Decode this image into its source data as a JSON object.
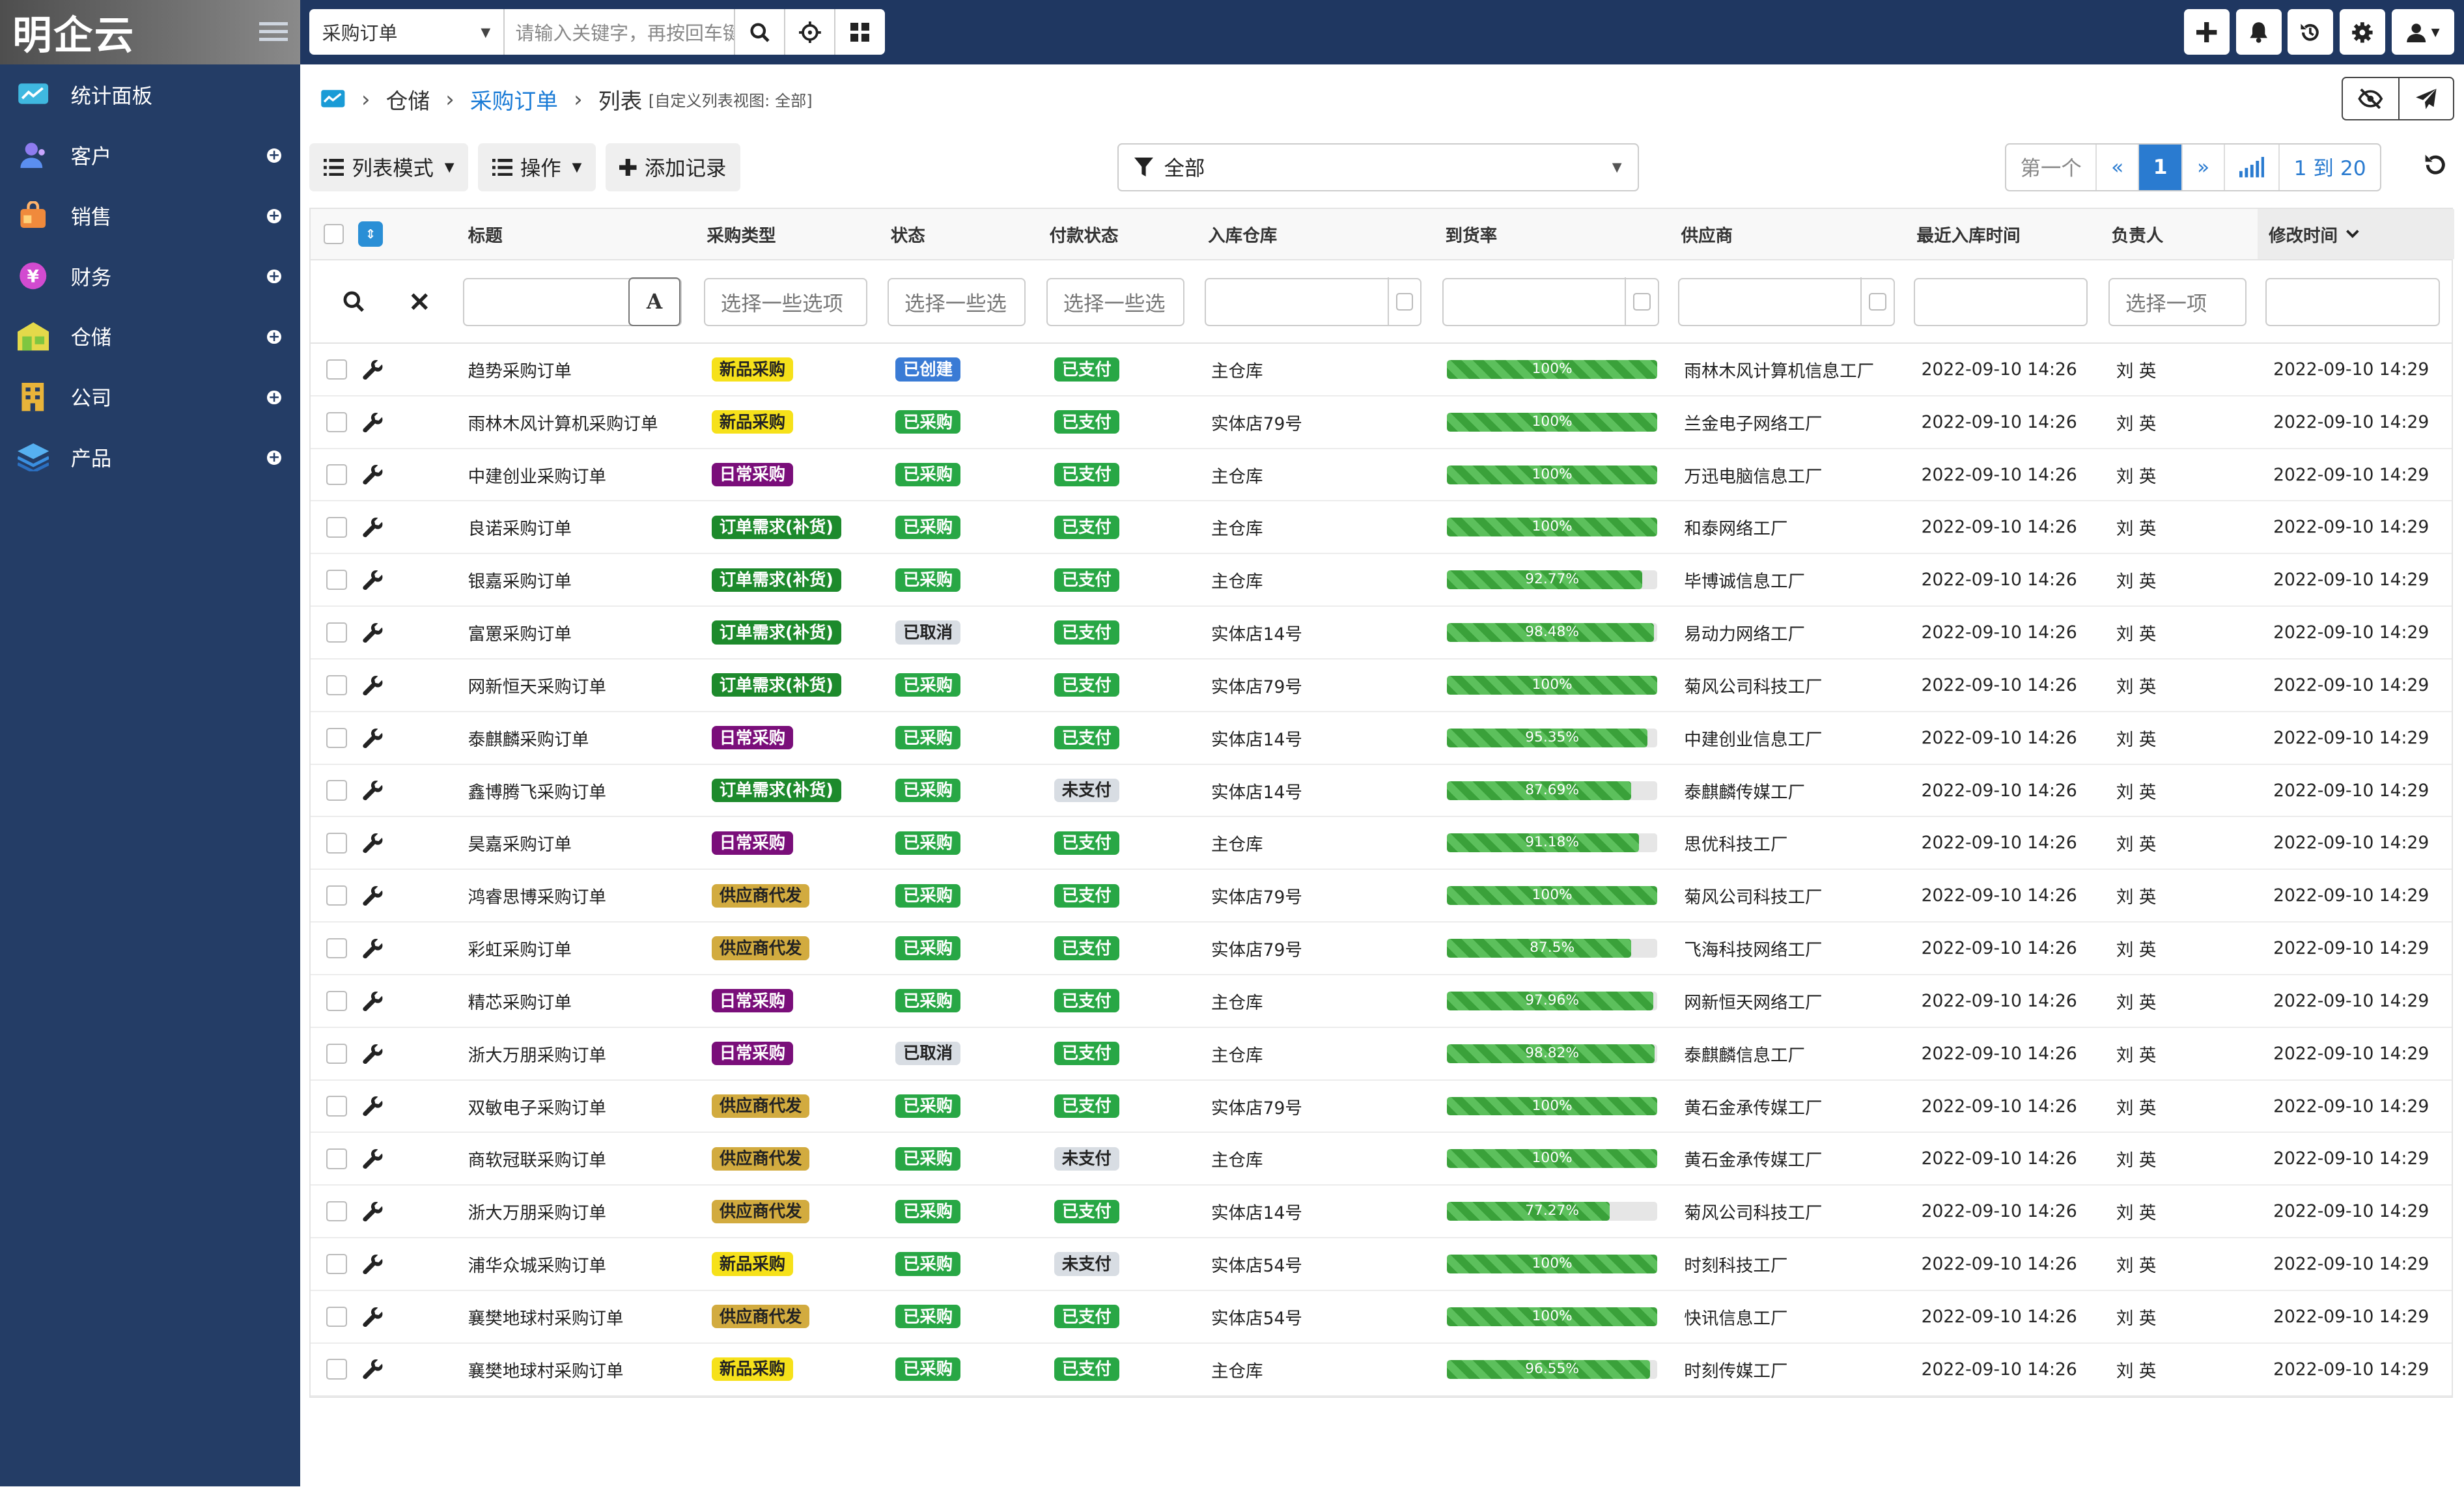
{
  "app": {
    "logo": "明企云"
  },
  "sidebar": {
    "items": [
      {
        "label": "统计面板",
        "icon": "chart-icon",
        "expandable": false
      },
      {
        "label": "客户",
        "icon": "users-icon",
        "expandable": true
      },
      {
        "label": "销售",
        "icon": "bag-icon",
        "expandable": true
      },
      {
        "label": "财务",
        "icon": "yen-icon",
        "expandable": true
      },
      {
        "label": "仓储",
        "icon": "warehouse-icon",
        "expandable": true
      },
      {
        "label": "公司",
        "icon": "building-icon",
        "expandable": true
      },
      {
        "label": "产品",
        "icon": "layers-icon",
        "expandable": true
      }
    ]
  },
  "topbar": {
    "module_select": "采购订单",
    "search_placeholder": "请输入关键字，再按回车键"
  },
  "breadcrumb": {
    "level1": "仓储",
    "level2": "采购订单",
    "level3": "列表",
    "note": "[自定义列表视图: 全部]"
  },
  "toolbar": {
    "list_mode": "列表模式",
    "actions": "操作",
    "add_record": "添加记录"
  },
  "filter": {
    "label": "全部"
  },
  "pager": {
    "first": "第一个",
    "prev": "«",
    "current": "1",
    "next": "»",
    "range": "1 到 20"
  },
  "columns": [
    "标题",
    "采购类型",
    "状态",
    "付款状态",
    "入库仓库",
    "到货率",
    "供应商",
    "最近入库时间",
    "负责人",
    "修改时间"
  ],
  "filters": {
    "type_placeholder": "选择一些选项",
    "status_placeholder": "选择一些选",
    "pay_placeholder": "选择一些选",
    "owner_placeholder": "选择一项",
    "text_toggle": "A"
  },
  "colors": {
    "sidebar": "#243d66",
    "topbar": "#1f3761",
    "link": "#1a7bd6",
    "progress": "#3aa13a"
  },
  "rows": [
    {
      "title": "趋势采购订单",
      "type": "新品采购",
      "status": "已创建",
      "pay": "已支付",
      "warehouse": "主仓库",
      "rate": 100,
      "rate_text": "100%",
      "supplier": "雨林木风计算机信息工厂",
      "in_time": "2022-09-10 14:26",
      "owner": "刘 英",
      "mod_time": "2022-09-10 14:29"
    },
    {
      "title": "雨林木风计算机采购订单",
      "type": "新品采购",
      "status": "已采购",
      "pay": "已支付",
      "warehouse": "实体店79号",
      "rate": 100,
      "rate_text": "100%",
      "supplier": "兰金电子网络工厂",
      "in_time": "2022-09-10 14:26",
      "owner": "刘 英",
      "mod_time": "2022-09-10 14:29"
    },
    {
      "title": "中建创业采购订单",
      "type": "日常采购",
      "status": "已采购",
      "pay": "已支付",
      "warehouse": "主仓库",
      "rate": 100,
      "rate_text": "100%",
      "supplier": "万迅电脑信息工厂",
      "in_time": "2022-09-10 14:26",
      "owner": "刘 英",
      "mod_time": "2022-09-10 14:29"
    },
    {
      "title": "良诺采购订单",
      "type": "订单需求(补货)",
      "status": "已采购",
      "pay": "已支付",
      "warehouse": "主仓库",
      "rate": 100,
      "rate_text": "100%",
      "supplier": "和泰网络工厂",
      "in_time": "2022-09-10 14:26",
      "owner": "刘 英",
      "mod_time": "2022-09-10 14:29"
    },
    {
      "title": "银嘉采购订单",
      "type": "订单需求(补货)",
      "status": "已采购",
      "pay": "已支付",
      "warehouse": "主仓库",
      "rate": 92.77,
      "rate_text": "92.77%",
      "supplier": "毕博诚信息工厂",
      "in_time": "2022-09-10 14:26",
      "owner": "刘 英",
      "mod_time": "2022-09-10 14:29"
    },
    {
      "title": "富罳采购订单",
      "type": "订单需求(补货)",
      "status": "已取消",
      "pay": "已支付",
      "warehouse": "实体店14号",
      "rate": 98.48,
      "rate_text": "98.48%",
      "supplier": "易动力网络工厂",
      "in_time": "2022-09-10 14:26",
      "owner": "刘 英",
      "mod_time": "2022-09-10 14:29"
    },
    {
      "title": "网新恒天采购订单",
      "type": "订单需求(补货)",
      "status": "已采购",
      "pay": "已支付",
      "warehouse": "实体店79号",
      "rate": 100,
      "rate_text": "100%",
      "supplier": "菊风公司科技工厂",
      "in_time": "2022-09-10 14:26",
      "owner": "刘 英",
      "mod_time": "2022-09-10 14:29"
    },
    {
      "title": "泰麒麟采购订单",
      "type": "日常采购",
      "status": "已采购",
      "pay": "已支付",
      "warehouse": "实体店14号",
      "rate": 95.35,
      "rate_text": "95.35%",
      "supplier": "中建创业信息工厂",
      "in_time": "2022-09-10 14:26",
      "owner": "刘 英",
      "mod_time": "2022-09-10 14:29"
    },
    {
      "title": "鑫博腾飞采购订单",
      "type": "订单需求(补货)",
      "status": "已采购",
      "pay": "未支付",
      "warehouse": "实体店14号",
      "rate": 87.69,
      "rate_text": "87.69%",
      "supplier": "泰麒麟传媒工厂",
      "in_time": "2022-09-10 14:26",
      "owner": "刘 英",
      "mod_time": "2022-09-10 14:29"
    },
    {
      "title": "昊嘉采购订单",
      "type": "日常采购",
      "status": "已采购",
      "pay": "已支付",
      "warehouse": "主仓库",
      "rate": 91.18,
      "rate_text": "91.18%",
      "supplier": "思优科技工厂",
      "in_time": "2022-09-10 14:26",
      "owner": "刘 英",
      "mod_time": "2022-09-10 14:29"
    },
    {
      "title": "鸿睿思博采购订单",
      "type": "供应商代发",
      "status": "已采购",
      "pay": "已支付",
      "warehouse": "实体店79号",
      "rate": 100,
      "rate_text": "100%",
      "supplier": "菊风公司科技工厂",
      "in_time": "2022-09-10 14:26",
      "owner": "刘 英",
      "mod_time": "2022-09-10 14:29"
    },
    {
      "title": "彩虹采购订单",
      "type": "供应商代发",
      "status": "已采购",
      "pay": "已支付",
      "warehouse": "实体店79号",
      "rate": 87.5,
      "rate_text": "87.5%",
      "supplier": "飞海科技网络工厂",
      "in_time": "2022-09-10 14:26",
      "owner": "刘 英",
      "mod_time": "2022-09-10 14:29"
    },
    {
      "title": "精芯采购订单",
      "type": "日常采购",
      "status": "已采购",
      "pay": "已支付",
      "warehouse": "主仓库",
      "rate": 97.96,
      "rate_text": "97.96%",
      "supplier": "网新恒天网络工厂",
      "in_time": "2022-09-10 14:26",
      "owner": "刘 英",
      "mod_time": "2022-09-10 14:29"
    },
    {
      "title": "浙大万朋采购订单",
      "type": "日常采购",
      "status": "已取消",
      "pay": "已支付",
      "warehouse": "主仓库",
      "rate": 98.82,
      "rate_text": "98.82%",
      "supplier": "泰麒麟信息工厂",
      "in_time": "2022-09-10 14:26",
      "owner": "刘 英",
      "mod_time": "2022-09-10 14:29"
    },
    {
      "title": "双敏电子采购订单",
      "type": "供应商代发",
      "status": "已采购",
      "pay": "已支付",
      "warehouse": "实体店79号",
      "rate": 100,
      "rate_text": "100%",
      "supplier": "黄石金承传媒工厂",
      "in_time": "2022-09-10 14:26",
      "owner": "刘 英",
      "mod_time": "2022-09-10 14:29"
    },
    {
      "title": "商软冠联采购订单",
      "type": "供应商代发",
      "status": "已采购",
      "pay": "未支付",
      "warehouse": "主仓库",
      "rate": 100,
      "rate_text": "100%",
      "supplier": "黄石金承传媒工厂",
      "in_time": "2022-09-10 14:26",
      "owner": "刘 英",
      "mod_time": "2022-09-10 14:29"
    },
    {
      "title": "浙大万朋采购订单",
      "type": "供应商代发",
      "status": "已采购",
      "pay": "已支付",
      "warehouse": "实体店14号",
      "rate": 77.27,
      "rate_text": "77.27%",
      "supplier": "菊风公司科技工厂",
      "in_time": "2022-09-10 14:26",
      "owner": "刘 英",
      "mod_time": "2022-09-10 14:29"
    },
    {
      "title": "浦华众城采购订单",
      "type": "新品采购",
      "status": "已采购",
      "pay": "未支付",
      "warehouse": "实体店54号",
      "rate": 100,
      "rate_text": "100%",
      "supplier": "时刻科技工厂",
      "in_time": "2022-09-10 14:26",
      "owner": "刘 英",
      "mod_time": "2022-09-10 14:29"
    },
    {
      "title": "襄樊地球村采购订单",
      "type": "供应商代发",
      "status": "已采购",
      "pay": "已支付",
      "warehouse": "实体店54号",
      "rate": 100,
      "rate_text": "100%",
      "supplier": "快讯信息工厂",
      "in_time": "2022-09-10 14:26",
      "owner": "刘 英",
      "mod_time": "2022-09-10 14:29"
    },
    {
      "title": "襄樊地球村采购订单",
      "type": "新品采购",
      "status": "已采购",
      "pay": "已支付",
      "warehouse": "主仓库",
      "rate": 96.55,
      "rate_text": "96.55%",
      "supplier": "时刻传媒工厂",
      "in_time": "2022-09-10 14:26",
      "owner": "刘 英",
      "mod_time": "2022-09-10 14:29"
    }
  ]
}
